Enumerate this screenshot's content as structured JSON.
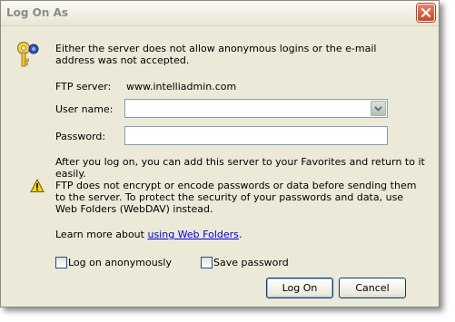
{
  "window": {
    "title": "Log On As"
  },
  "icons": {
    "title_close": "close-icon",
    "key": "key-icon",
    "warning": "warning-icon",
    "dropdown": "chevron-down-icon"
  },
  "message": "Either the server does not allow anonymous logins or the e-mail address was not accepted.",
  "ftp_server": {
    "label": "FTP server:",
    "value": "www.intelliadmin.com"
  },
  "username": {
    "label": "User name:",
    "value": ""
  },
  "password": {
    "label": "Password:",
    "value": ""
  },
  "after_logon_text": "After you log on, you can add this server to your Favorites and return to it easily.",
  "warning_text": "FTP does not encrypt or encode passwords or data before sending them to the server.  To protect the security of your passwords and data, use Web Folders (WebDAV) instead.",
  "learn_more": {
    "prefix": "Learn more about ",
    "link": "using Web Folders",
    "suffix": "."
  },
  "options": {
    "anonymous": {
      "label": "Log on anonymously",
      "checked": false
    },
    "save_password": {
      "label": "Save password",
      "checked": false
    }
  },
  "buttons": {
    "logon": "Log On",
    "cancel": "Cancel"
  },
  "colors": {
    "link": "#0000e0",
    "dialog_bg": "#ece9d8",
    "close_red": "#c54a2b",
    "field_border": "#7f9db9"
  }
}
